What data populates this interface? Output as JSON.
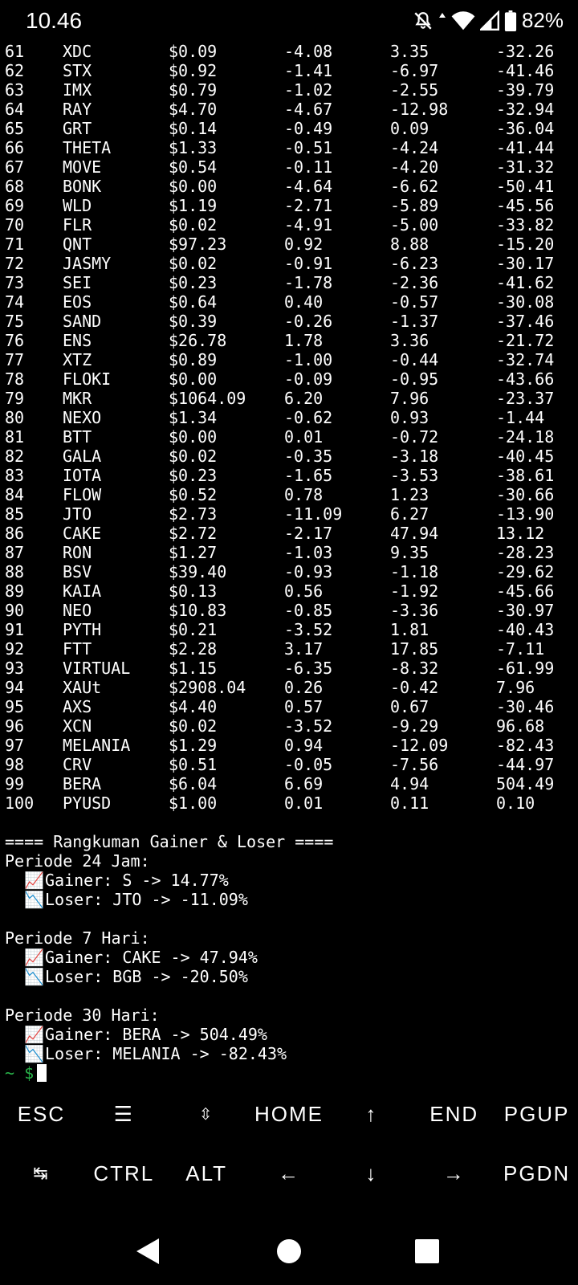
{
  "status": {
    "time": "10.46",
    "battery": "82%"
  },
  "rows": [
    [
      "61",
      "XDC",
      "$0.09",
      "-4.08",
      "3.35",
      "-32.26"
    ],
    [
      "62",
      "STX",
      "$0.92",
      "-1.41",
      "-6.97",
      "-41.46"
    ],
    [
      "63",
      "IMX",
      "$0.79",
      "-1.02",
      "-2.55",
      "-39.79"
    ],
    [
      "64",
      "RAY",
      "$4.70",
      "-4.67",
      "-12.98",
      "-32.94"
    ],
    [
      "65",
      "GRT",
      "$0.14",
      "-0.49",
      "0.09",
      "-36.04"
    ],
    [
      "66",
      "THETA",
      "$1.33",
      "-0.51",
      "-4.24",
      "-41.44"
    ],
    [
      "67",
      "MOVE",
      "$0.54",
      "-0.11",
      "-4.20",
      "-31.32"
    ],
    [
      "68",
      "BONK",
      "$0.00",
      "-4.64",
      "-6.62",
      "-50.41"
    ],
    [
      "69",
      "WLD",
      "$1.19",
      "-2.71",
      "-5.89",
      "-45.56"
    ],
    [
      "70",
      "FLR",
      "$0.02",
      "-4.91",
      "-5.00",
      "-33.82"
    ],
    [
      "71",
      "QNT",
      "$97.23",
      "0.92",
      "8.88",
      "-15.20"
    ],
    [
      "72",
      "JASMY",
      "$0.02",
      "-0.91",
      "-6.23",
      "-30.17"
    ],
    [
      "73",
      "SEI",
      "$0.23",
      "-1.78",
      "-2.36",
      "-41.62"
    ],
    [
      "74",
      "EOS",
      "$0.64",
      "0.40",
      "-0.57",
      "-30.08"
    ],
    [
      "75",
      "SAND",
      "$0.39",
      "-0.26",
      "-1.37",
      "-37.46"
    ],
    [
      "76",
      "ENS",
      "$26.78",
      "1.78",
      "3.36",
      "-21.72"
    ],
    [
      "77",
      "XTZ",
      "$0.89",
      "-1.00",
      "-0.44",
      "-32.74"
    ],
    [
      "78",
      "FLOKI",
      "$0.00",
      "-0.09",
      "-0.95",
      "-43.66"
    ],
    [
      "79",
      "MKR",
      "$1064.09",
      "6.20",
      "7.96",
      "-23.37"
    ],
    [
      "80",
      "NEXO",
      "$1.34",
      "-0.62",
      "0.93",
      "-1.44"
    ],
    [
      "81",
      "BTT",
      "$0.00",
      "0.01",
      "-0.72",
      "-24.18"
    ],
    [
      "82",
      "GALA",
      "$0.02",
      "-0.35",
      "-3.18",
      "-40.45"
    ],
    [
      "83",
      "IOTA",
      "$0.23",
      "-1.65",
      "-3.53",
      "-38.61"
    ],
    [
      "84",
      "FLOW",
      "$0.52",
      "0.78",
      "1.23",
      "-30.66"
    ],
    [
      "85",
      "JTO",
      "$2.73",
      "-11.09",
      "6.27",
      "-13.90"
    ],
    [
      "86",
      "CAKE",
      "$2.72",
      "-2.17",
      "47.94",
      "13.12"
    ],
    [
      "87",
      "RON",
      "$1.27",
      "-1.03",
      "9.35",
      "-28.23"
    ],
    [
      "88",
      "BSV",
      "$39.40",
      "-0.93",
      "-1.18",
      "-29.62"
    ],
    [
      "89",
      "KAIA",
      "$0.13",
      "0.56",
      "-1.92",
      "-45.66"
    ],
    [
      "90",
      "NEO",
      "$10.83",
      "-0.85",
      "-3.36",
      "-30.97"
    ],
    [
      "91",
      "PYTH",
      "$0.21",
      "-3.52",
      "1.81",
      "-40.43"
    ],
    [
      "92",
      "FTT",
      "$2.28",
      "3.17",
      "17.85",
      "-7.11"
    ],
    [
      "93",
      "VIRTUAL",
      "$1.15",
      "-6.35",
      "-8.32",
      "-61.99"
    ],
    [
      "94",
      "XAUt",
      "$2908.04",
      "0.26",
      "-0.42",
      "7.96"
    ],
    [
      "95",
      "AXS",
      "$4.40",
      "0.57",
      "0.67",
      "-30.46"
    ],
    [
      "96",
      "XCN",
      "$0.02",
      "-3.52",
      "-9.29",
      "96.68"
    ],
    [
      "97",
      "MELANIA",
      "$1.29",
      "0.94",
      "-12.09",
      "-82.43"
    ],
    [
      "98",
      "CRV",
      "$0.51",
      "-0.05",
      "-7.56",
      "-44.97"
    ],
    [
      "99",
      "BERA",
      "$6.04",
      "6.69",
      "4.94",
      "504.49"
    ],
    [
      "100",
      "PYUSD",
      "$1.00",
      "0.01",
      "0.11",
      "0.10"
    ]
  ],
  "summary": {
    "header": "==== Rangkuman Gainer & Loser ====",
    "periods": [
      {
        "title": "Periode 24 Jam:",
        "gainer": "Gainer: S -> 14.77%",
        "loser": "Loser: JTO -> -11.09%"
      },
      {
        "title": "Periode 7 Hari:",
        "gainer": "Gainer: CAKE -> 47.94%",
        "loser": "Loser: BGB -> -20.50%"
      },
      {
        "title": "Periode 30 Hari:",
        "gainer": "Gainer: BERA -> 504.49%",
        "loser": "Loser: MELANIA -> -82.43%"
      }
    ],
    "gainer_emoji": "📈",
    "loser_emoji": "📉"
  },
  "prompt": {
    "tilde": "~",
    "dollar": "$"
  },
  "keys": {
    "row1": [
      "ESC",
      "☰",
      "⇳",
      "HOME",
      "↑",
      "END",
      "PGUP"
    ],
    "row2": [
      "↹",
      "CTRL",
      "ALT",
      "←",
      "↓",
      "→",
      "PGDN"
    ]
  }
}
